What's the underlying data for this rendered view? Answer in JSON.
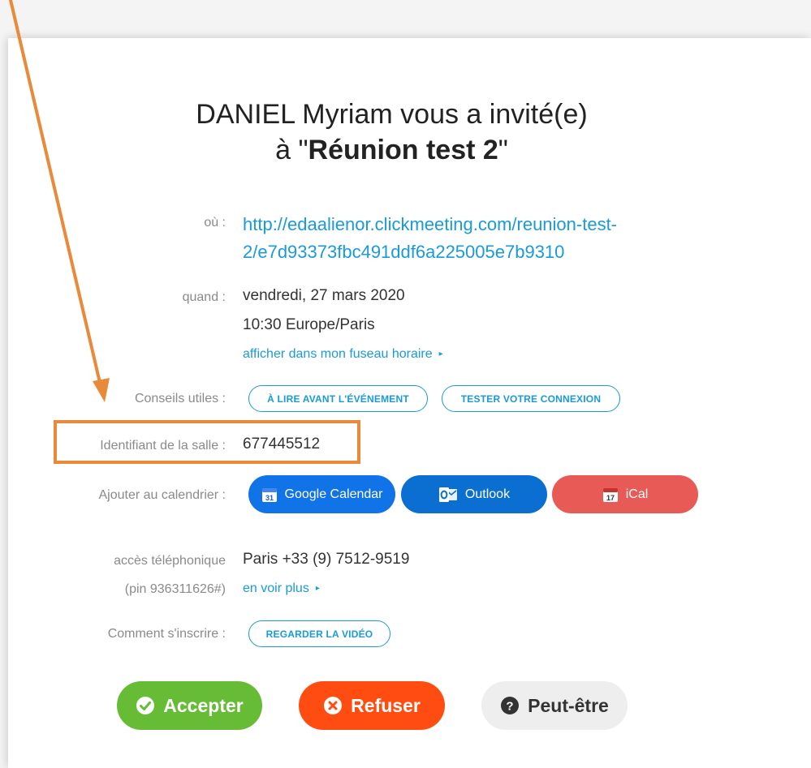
{
  "heading": {
    "line1": "DANIEL Myriam vous a invité(e)",
    "line2_prefix": "à \"",
    "meeting_name": "Réunion test 2",
    "line2_suffix": "\""
  },
  "where": {
    "label": "où :",
    "url_line1": "http://edaalienor.clickmeeting.com/reunion-test-",
    "url_line2": "2/e7d93373fbc491ddf6a225005e7b9310"
  },
  "when": {
    "label": "quand :",
    "date": "vendredi, 27 mars 2020",
    "time": "10:30 Europe/Paris",
    "timezone_link": "afficher dans mon fuseau horaire"
  },
  "tips": {
    "label": "Conseils utiles :",
    "read_before": "À LIRE AVANT L'ÉVÉNEMENT",
    "test_connection": "TESTER VOTRE CONNEXION"
  },
  "room": {
    "label": "Identifiant de la salle :",
    "id": "677445512"
  },
  "calendar": {
    "label": "Ajouter au calendrier :",
    "google": "Google Calendar",
    "outlook": "Outlook",
    "ical": "iCal",
    "google_day": "31",
    "ical_day": "17"
  },
  "phone": {
    "label": "accès téléphonique",
    "pin": "(pin 936311626#)",
    "number": "Paris +33 (9) 7512-9519",
    "more_link": "en voir plus"
  },
  "register": {
    "label": "Comment s'inscrire :",
    "video": "REGARDER LA VIDÉO"
  },
  "rsvp": {
    "accept": "Accepter",
    "decline": "Refuser",
    "maybe": "Peut-être"
  },
  "colors": {
    "link_blue": "#1a9ad8",
    "google_blue": "#1173e8",
    "outlook_blue": "#0a6fd0",
    "ical_red": "#e85a55",
    "accept_green": "#67bc36",
    "decline_orange": "#ff4d12",
    "maybe_gray": "#eeeeee",
    "annotation_orange": "#e98a3a"
  },
  "icons": [
    "google-calendar-icon",
    "outlook-icon",
    "ical-icon",
    "check-circle-icon",
    "x-circle-icon",
    "question-circle-icon",
    "caret-right-icon"
  ]
}
